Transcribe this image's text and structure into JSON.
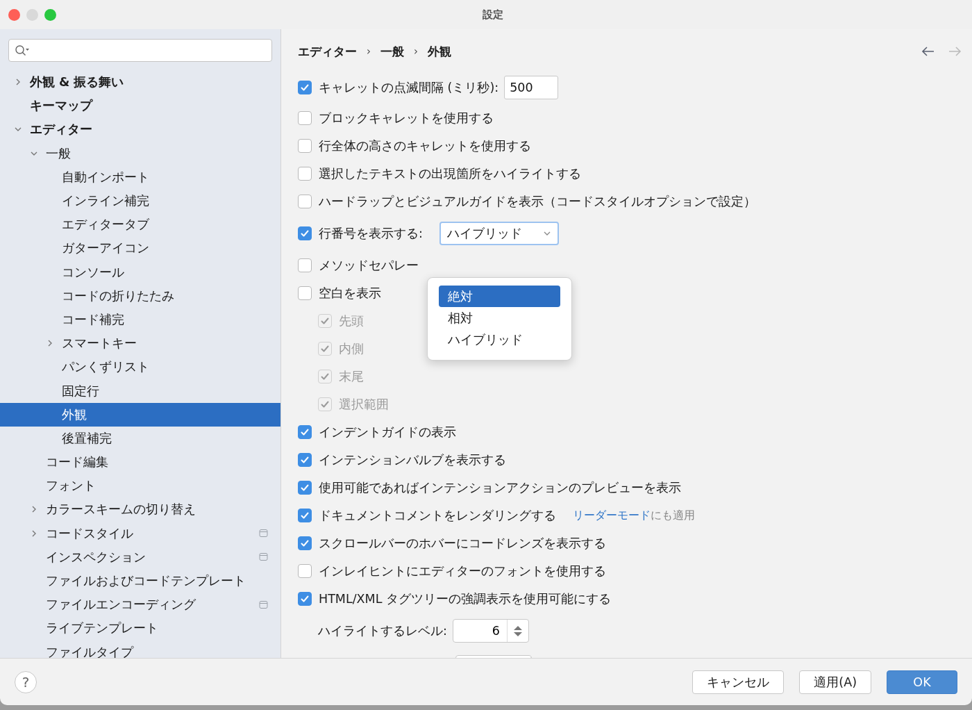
{
  "window": {
    "title": "設定"
  },
  "sidebar": {
    "items": [
      {
        "label": "外観 & 振る舞い",
        "selected": false,
        "expanded": false
      },
      {
        "label": "キーマップ",
        "selected": false
      },
      {
        "label": "エディター",
        "selected": false,
        "expanded": true,
        "children": [
          {
            "label": "一般",
            "selected": false,
            "expanded": true,
            "children": [
              {
                "label": "自動インポート",
                "selected": false
              },
              {
                "label": "インライン補完",
                "selected": false
              },
              {
                "label": "エディタータブ",
                "selected": false
              },
              {
                "label": "ガターアイコン",
                "selected": false
              },
              {
                "label": "コンソール",
                "selected": false
              },
              {
                "label": "コードの折りたたみ",
                "selected": false
              },
              {
                "label": "コード補完",
                "selected": false
              },
              {
                "label": "スマートキー",
                "selected": false,
                "expanded": false
              },
              {
                "label": "パンくずリスト",
                "selected": false
              },
              {
                "label": "固定行",
                "selected": false
              },
              {
                "label": "外観",
                "selected": true
              },
              {
                "label": "後置補完",
                "selected": false
              }
            ]
          },
          {
            "label": "コード編集",
            "selected": false
          },
          {
            "label": "フォント",
            "selected": false
          },
          {
            "label": "カラースキームの切り替え",
            "selected": false,
            "expanded": false
          },
          {
            "label": "コードスタイル",
            "selected": false,
            "expanded": false,
            "project_scope": true
          },
          {
            "label": "インスペクション",
            "selected": false,
            "project_scope": true
          },
          {
            "label": "ファイルおよびコードテンプレート",
            "selected": false
          },
          {
            "label": "ファイルエンコーディング",
            "selected": false,
            "project_scope": true
          },
          {
            "label": "ライブテンプレート",
            "selected": false
          },
          {
            "label": "ファイルタイプ",
            "selected": false
          }
        ]
      }
    ]
  },
  "breadcrumb": {
    "separator": "›",
    "items": [
      "エディター",
      "一般",
      "外観"
    ]
  },
  "navigation": {
    "back_disabled": false,
    "forward_disabled": true
  },
  "options": [
    {
      "kind": "checkbox_field",
      "label": "キャレットの点滅間隔 (ミリ秒):",
      "checked": true,
      "value": "500"
    },
    {
      "kind": "checkbox",
      "label": "ブロックキャレットを使用する",
      "checked": false
    },
    {
      "kind": "checkbox",
      "label": "行全体の高さのキャレットを使用する",
      "checked": false
    },
    {
      "kind": "checkbox",
      "label": "選択したテキストの出現箇所をハイライトする",
      "checked": false
    },
    {
      "kind": "checkbox",
      "label": "ハードラップとビジュアルガイドを表示（コードスタイルオプションで設定）",
      "checked": false
    },
    {
      "kind": "checkbox_dropdown",
      "label": "行番号を表示する:",
      "checked": true,
      "value": "ハイブリッド",
      "expanded": true,
      "menu": [
        {
          "label": "絶対",
          "highlighted": true
        },
        {
          "label": "相対",
          "highlighted": false
        },
        {
          "label": "ハイブリッド",
          "highlighted": false
        }
      ]
    },
    {
      "kind": "checkbox",
      "label": "メソッドセパレー",
      "checked": false
    },
    {
      "kind": "checkbox",
      "label": "空白を表示",
      "checked": false
    },
    {
      "kind": "sub_checkbox",
      "label": "先頭",
      "checked": true,
      "disabled": true
    },
    {
      "kind": "sub_checkbox",
      "label": "内側",
      "checked": true,
      "disabled": true
    },
    {
      "kind": "sub_checkbox",
      "label": "末尾",
      "checked": true,
      "disabled": true
    },
    {
      "kind": "sub_checkbox",
      "label": "選択範囲",
      "checked": true,
      "disabled": true
    },
    {
      "kind": "checkbox",
      "label": "インデントガイドの表示",
      "checked": true
    },
    {
      "kind": "checkbox",
      "label": "インテンションバルブを表示する",
      "checked": true
    },
    {
      "kind": "checkbox",
      "label": "使用可能であればインテンションアクションのプレビューを表示",
      "checked": true
    },
    {
      "kind": "checkbox_link",
      "label": "ドキュメントコメントをレンダリングする",
      "checked": true,
      "link": "リーダーモード",
      "note": "にも適用"
    },
    {
      "kind": "checkbox",
      "label": "スクロールバーのホバーにコードレンズを表示する",
      "checked": true
    },
    {
      "kind": "checkbox",
      "label": "インレイヒントにエディターのフォントを使用する",
      "checked": false
    },
    {
      "kind": "checkbox",
      "label": "HTML/XML タグツリーの強調表示を使用可能にする",
      "checked": true
    },
    {
      "kind": "spinner",
      "label": "ハイライトするレベル:",
      "value": "6"
    },
    {
      "kind": "spinner"
    }
  ],
  "footer": {
    "help": "?",
    "buttons": [
      {
        "label": "キャンセル",
        "kind": "default"
      },
      {
        "label": "適用(A)",
        "kind": "default"
      },
      {
        "label": "OK",
        "kind": "primary"
      }
    ]
  }
}
